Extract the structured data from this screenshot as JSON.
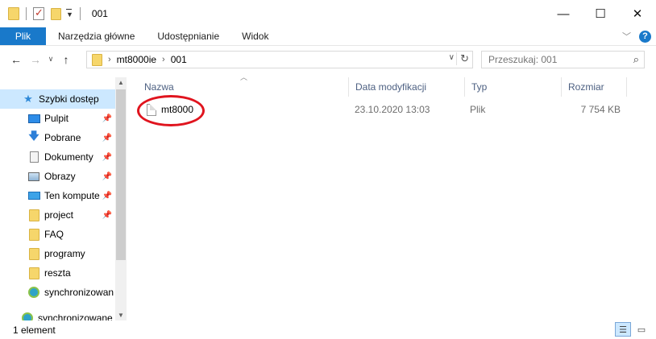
{
  "window": {
    "title": "001"
  },
  "ribbon": {
    "tabs": [
      "Plik",
      "Narzędzia główne",
      "Udostępnianie",
      "Widok"
    ],
    "help_label": "?"
  },
  "address": {
    "crumbs": [
      "mt8000ie",
      "001"
    ]
  },
  "search": {
    "placeholder": "Przeszukaj: 001"
  },
  "nav": {
    "items": [
      {
        "label": "Szybki dostęp",
        "icon": "star-icon",
        "pinned": false,
        "selected": true
      },
      {
        "label": "Pulpit",
        "icon": "desktop-icon",
        "pinned": true
      },
      {
        "label": "Pobrane",
        "icon": "download-icon",
        "pinned": true
      },
      {
        "label": "Dokumenty",
        "icon": "document-icon",
        "pinned": true
      },
      {
        "label": "Obrazy",
        "icon": "pictures-icon",
        "pinned": true
      },
      {
        "label": "Ten kompute",
        "icon": "computer-icon",
        "pinned": true
      },
      {
        "label": "project",
        "icon": "folder-icon",
        "pinned": true
      },
      {
        "label": "FAQ",
        "icon": "folder-icon",
        "pinned": false
      },
      {
        "label": "programy",
        "icon": "folder-icon",
        "pinned": false
      },
      {
        "label": "reszta",
        "icon": "folder-icon",
        "pinned": false
      },
      {
        "label": "synchronizowan",
        "icon": "sync-icon",
        "pinned": false
      },
      {
        "label": "synchronizowane",
        "icon": "sync-icon",
        "pinned": false
      }
    ]
  },
  "columns": {
    "name": "Nazwa",
    "modified": "Data modyfikacji",
    "type": "Typ",
    "size": "Rozmiar"
  },
  "files": [
    {
      "name": "mt8000",
      "modified": "23.10.2020 13:03",
      "type": "Plik",
      "size": "7 754 KB",
      "highlighted": true
    }
  ],
  "status": {
    "count": "1 element"
  },
  "colors": {
    "accent": "#1979ca",
    "selection": "#cce8ff",
    "highlight": "#e0141e",
    "folder": "#f6d66b"
  }
}
